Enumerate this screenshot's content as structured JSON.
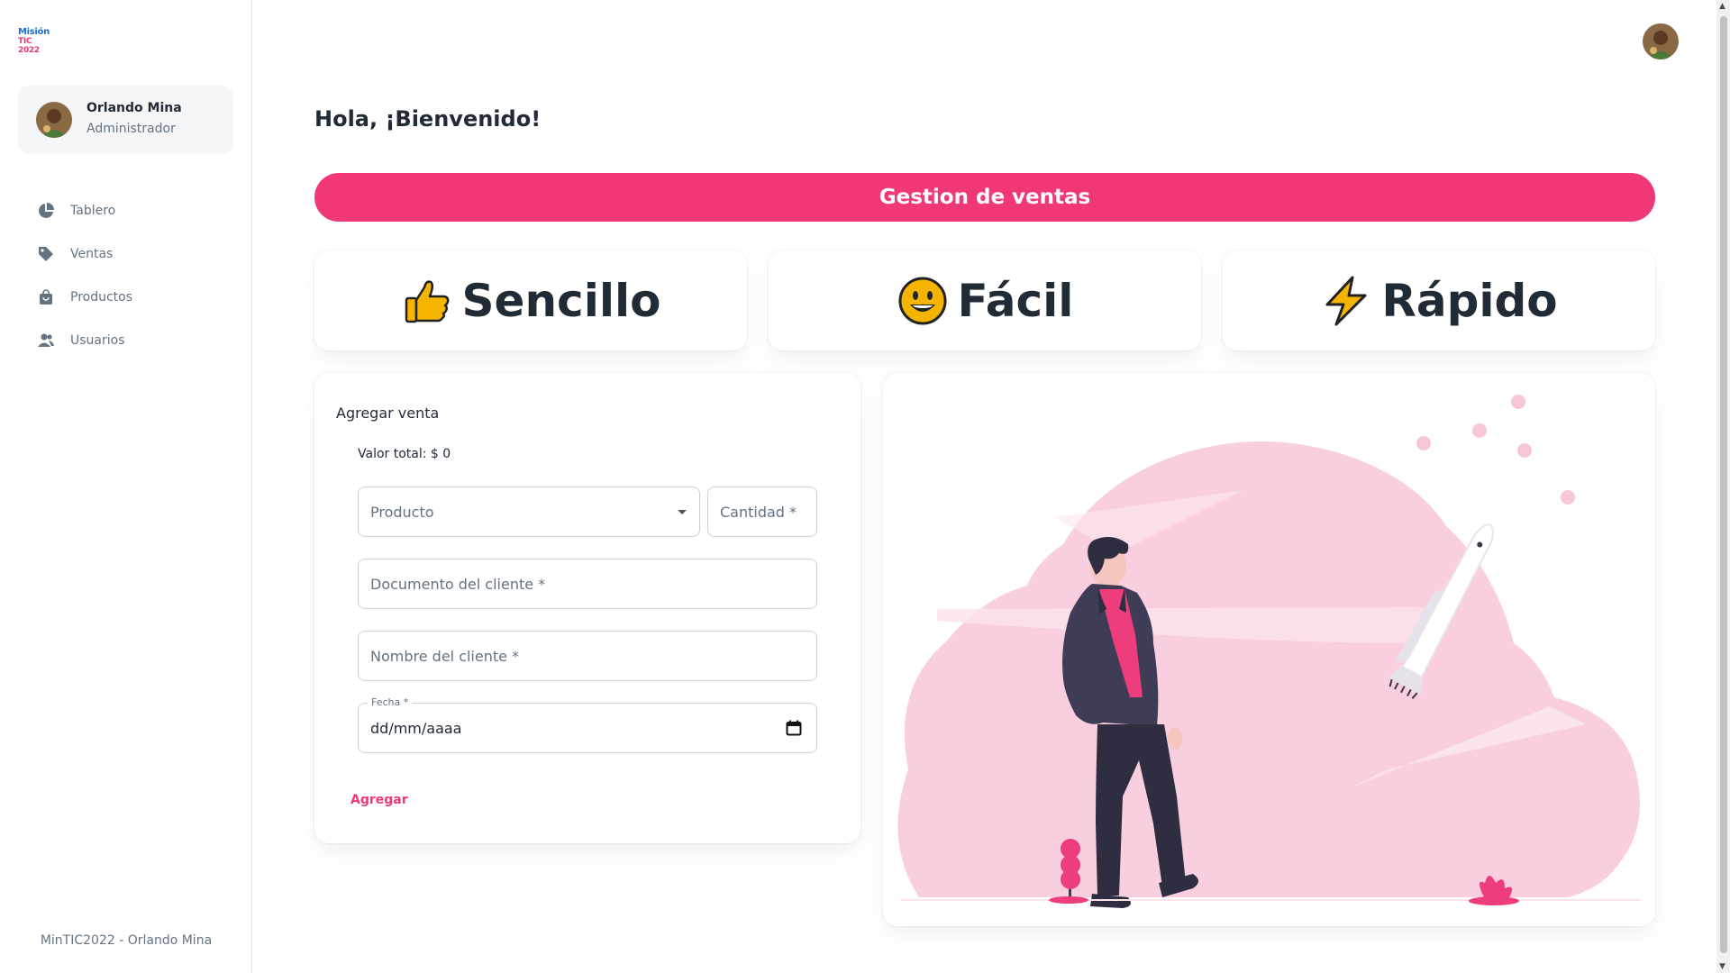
{
  "brand": {
    "logo_line1": "Misión",
    "logo_line2": "TIC 2022"
  },
  "account": {
    "name": "Orlando Mina",
    "role": "Administrador"
  },
  "nav": [
    {
      "label": "Tablero",
      "icon": "pie-chart-icon"
    },
    {
      "label": "Ventas",
      "icon": "tag-icon"
    },
    {
      "label": "Productos",
      "icon": "shopping-bag-icon"
    },
    {
      "label": "Usuarios",
      "icon": "people-icon"
    }
  ],
  "footer": "MinTIC2022 - Orlando Mina",
  "main": {
    "greeting": "Hola, ¡Bienvenido!",
    "banner": "Gestion de ventas",
    "features": [
      {
        "label": "Sencillo",
        "icon": "thumbs-up-icon"
      },
      {
        "label": "Fácil",
        "icon": "grinning-face-icon"
      },
      {
        "label": "Rápido",
        "icon": "lightning-icon"
      }
    ]
  },
  "form": {
    "title": "Agregar venta",
    "total_label": "Valor total: $ 0",
    "producto_placeholder": "Producto",
    "cantidad_placeholder": "Cantidad *",
    "documento_placeholder": "Documento del cliente *",
    "nombre_placeholder": "Nombre del cliente *",
    "fecha_label": "Fecha *",
    "fecha_value": "dd/mm/aaaa",
    "submit_label": "Agregar"
  },
  "colors": {
    "accent": "#f03876",
    "text": "#212b36",
    "muted": "#637381",
    "illustration_pink": "#f8c8d9"
  }
}
